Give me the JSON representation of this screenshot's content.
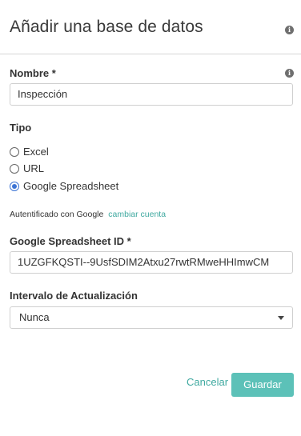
{
  "dialog": {
    "title": "Añadir una base de datos"
  },
  "name_field": {
    "label": "Nombre *",
    "value": "Inspección"
  },
  "type_field": {
    "label": "Tipo",
    "options": [
      "Excel",
      "URL",
      "Google Spreadsheet"
    ],
    "selected": "Google Spreadsheet"
  },
  "auth": {
    "text": "Autentificado con Google",
    "link_label": "cambiar cuenta"
  },
  "spreadsheet_id_field": {
    "label": "Google Spreadsheet ID *",
    "value": "1UZGFKQSTI--9UsfSDIM2Atxu27rwtRMweHHImwCM"
  },
  "interval_field": {
    "label": "Intervalo de Actualización",
    "selected": "Nunca"
  },
  "actions": {
    "cancel_label": "Cancelar",
    "save_label": "Guardar"
  },
  "colors": {
    "accent": "#5cc1b8",
    "link": "#3fa9a0",
    "radio_selected": "#3b73d4"
  },
  "icons": [
    "info-icon",
    "chevron-down-icon"
  ]
}
